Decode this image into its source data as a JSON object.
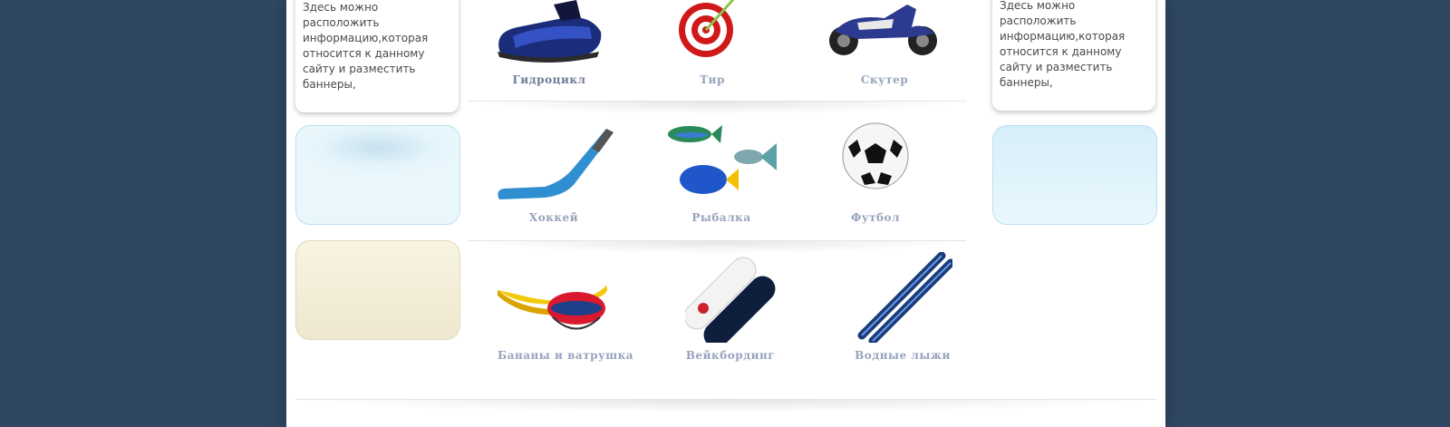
{
  "sidebar_left": {
    "info_text": "Здесь можно расположить информацию,которая относится к данному сайту и разместить баннеры,"
  },
  "sidebar_right": {
    "info_text": "Здесь можно расположить информацию,которая относится к данному сайту и разместить баннеры,"
  },
  "products": [
    {
      "label": "Гидроцикл",
      "icon": "jet-ski-icon"
    },
    {
      "label": "Тир",
      "icon": "target-icon"
    },
    {
      "label": "Скутер",
      "icon": "scooter-icon"
    },
    {
      "label": "Хоккей",
      "icon": "hockey-stick-icon"
    },
    {
      "label": "Рыбалка",
      "icon": "fish-icon"
    },
    {
      "label": "Футбол",
      "icon": "soccer-ball-icon"
    },
    {
      "label": "Бананы и ватрушка",
      "icon": "banana-boat-icon"
    },
    {
      "label": "Вейкбординг",
      "icon": "wakeboard-icon"
    },
    {
      "label": "Водные лыжи",
      "icon": "water-skis-icon"
    }
  ],
  "colors": {
    "background": "#2f4763",
    "label": "#97a3bd",
    "banner_blue": "#e4f4fb",
    "banner_cream": "#f3eedb"
  }
}
